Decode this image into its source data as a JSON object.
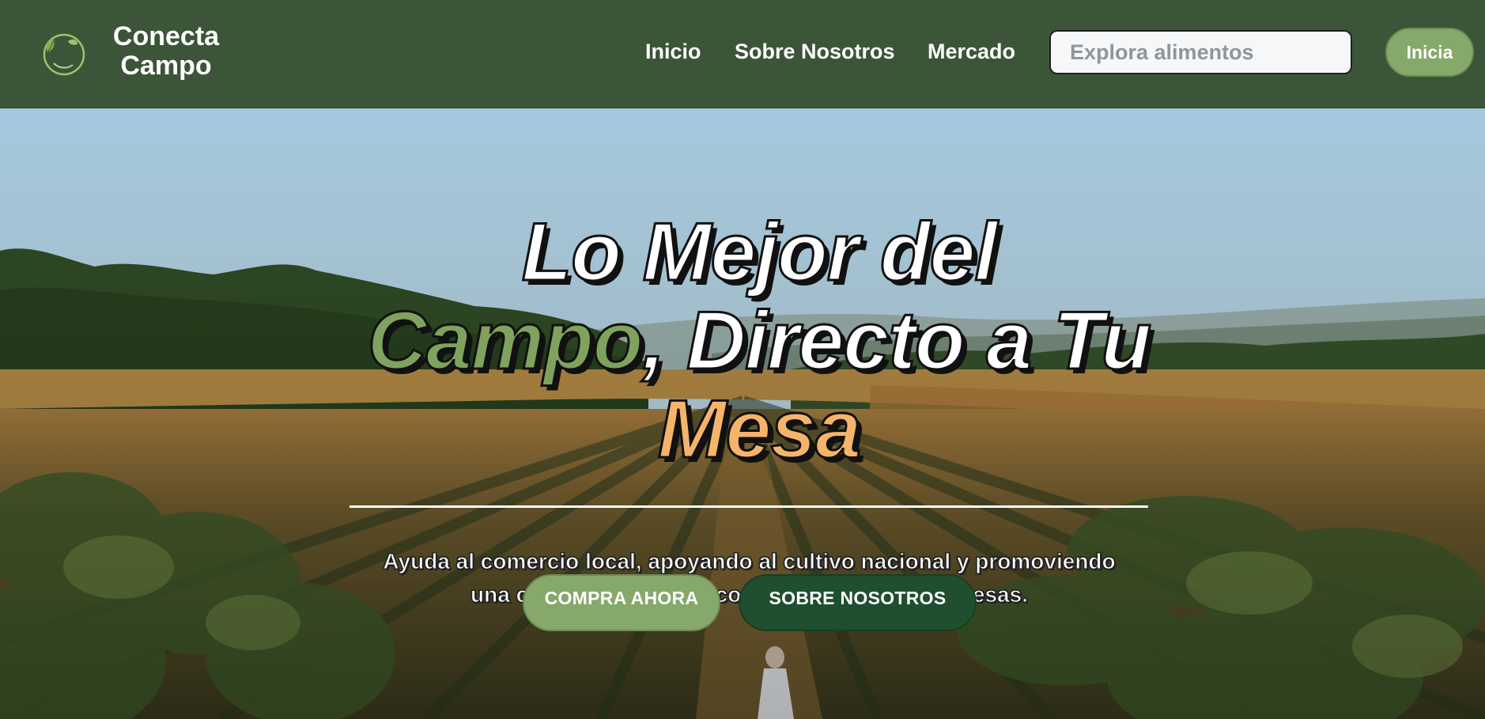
{
  "header": {
    "brand_line1": "Conecta",
    "brand_line2": "Campo",
    "logo_icon": "leaf-circle-icon",
    "nav": {
      "inicio": "Inicio",
      "sobre": "Sobre Nosotros",
      "mercado": "Mercado"
    },
    "search": {
      "placeholder": "Explora alimentos",
      "value": ""
    },
    "login_label": "Inicia"
  },
  "hero": {
    "title_part1": "Lo Mejor del",
    "title_green": "Campo",
    "title_part2": ", Directo a Tu",
    "title_orange": "Mesa",
    "subtitle": "Ayuda al comercio local, apoyando al cultivo nacional y promoviendo una competencia justa contra las grandes empresas.",
    "buy_label": "COMPRA AHORA",
    "about_label": "SOBRE NOSOTROS"
  },
  "colors": {
    "navbar": "#3c5539",
    "accent_green": "#86a86a",
    "title_green": "#7fa35e",
    "title_orange": "#f6b46b",
    "dark_green_button": "#1f4f2e"
  }
}
